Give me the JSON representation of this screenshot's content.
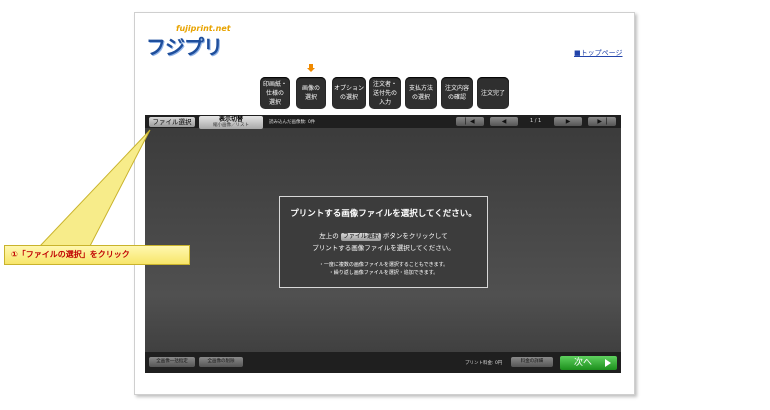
{
  "logo": {
    "sub": "fujiprint.net",
    "main": "フジプリ"
  },
  "header": {
    "top_link": "■トップページ"
  },
  "steps": [
    {
      "label": "印画紙・\n仕様の\n選択",
      "active": false
    },
    {
      "label": "画像の\n選択",
      "active": true
    },
    {
      "label": "オプション\nの選択",
      "active": false
    },
    {
      "label": "注文者・\n送付先の\n入力",
      "active": false
    },
    {
      "label": "支払方法\nの選択",
      "active": false
    },
    {
      "label": "注文内容\nの確認",
      "active": false
    },
    {
      "label": "注文完了",
      "active": false
    }
  ],
  "toolbar": {
    "file_select": "ファイル選択",
    "view_toggle_main": "表示切替",
    "view_toggle_sub": "縮小画像／リスト",
    "loaded_count": "読み込んだ画像数: 0件",
    "page_count": "1 / 1"
  },
  "dialog": {
    "title": "プリントする画像ファイルを選択してください。",
    "line1_pre": "左上の",
    "line1_btn": "ファイル選択",
    "line1_post": "ボタンをクリックして",
    "line2": "プリントする画像ファイルを選択してください。",
    "note1": "・一度に複数の画像ファイルを選択することもできます。",
    "note2": "・繰り返し画像ファイルを選択・追加できます。"
  },
  "bottombar": {
    "bulk_set": "全画像一括指定",
    "delete_all": "全画像の削除",
    "price_label": "プリント料金: 0円",
    "fee_detail": "料金の詳細",
    "next": "次へ"
  },
  "callout": {
    "text": "①「ファイルの選択」をクリック"
  },
  "colors": {
    "accent_green": "#2ea82e",
    "step_active_arrow": "#f08a00",
    "callout_text": "#c00000"
  }
}
